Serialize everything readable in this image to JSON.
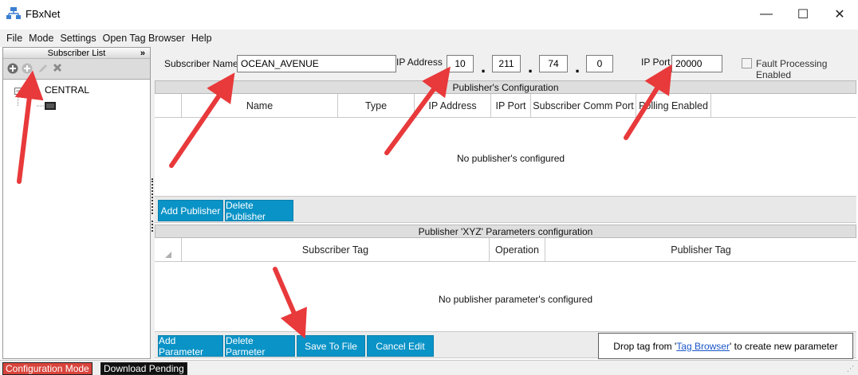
{
  "window": {
    "title": "FBxNet",
    "minimize": "—",
    "maximize": "☐",
    "close": "✕"
  },
  "menu": [
    "File",
    "Mode",
    "Settings",
    "Open Tag Browser",
    "Help"
  ],
  "left_panel": {
    "header": "Subscriber List",
    "collapse": "»",
    "tree_expander": "−",
    "tree_root": "CENTRAL"
  },
  "subscriber": {
    "name_label": "Subscriber Name",
    "name_value": "OCEAN_AVENUE",
    "ip_label": "IP Address",
    "ip_octets": [
      "10",
      "211",
      "74",
      "0"
    ],
    "ip_dot": ".",
    "port_label": "IP Port",
    "port_value": "20000",
    "fault_label": "Fault Processing Enabled"
  },
  "publishers": {
    "header": "Publisher's Configuration",
    "columns": [
      "Name",
      "Type",
      "IP Address",
      "IP Port",
      "Subscriber Comm Port",
      "Polling Enabled"
    ],
    "empty_message": "No publisher's configured",
    "add_button": "Add Publisher",
    "delete_button": "Delete Publisher"
  },
  "parameters": {
    "header": "Publisher 'XYZ' Parameters configuration",
    "columns": [
      "Subscriber Tag",
      "Operation",
      "Publisher Tag"
    ],
    "empty_message": "No publisher parameter's configured",
    "add_button": "Add Parameter",
    "delete_button": "Delete Parmeter",
    "save_button": "Save To File",
    "cancel_button": "Cancel Edit"
  },
  "drop_hint": {
    "prefix": "Drop tag from '",
    "link": "Tag Browser",
    "suffix": "' to create new parameter"
  },
  "status": {
    "mode": "Configuration Mode",
    "pending": "Download Pending"
  },
  "colors": {
    "accent_button": "#0a93c7",
    "arrow": "#e8393b",
    "status_mode": "#c0392b",
    "status_pending": "#111111"
  }
}
